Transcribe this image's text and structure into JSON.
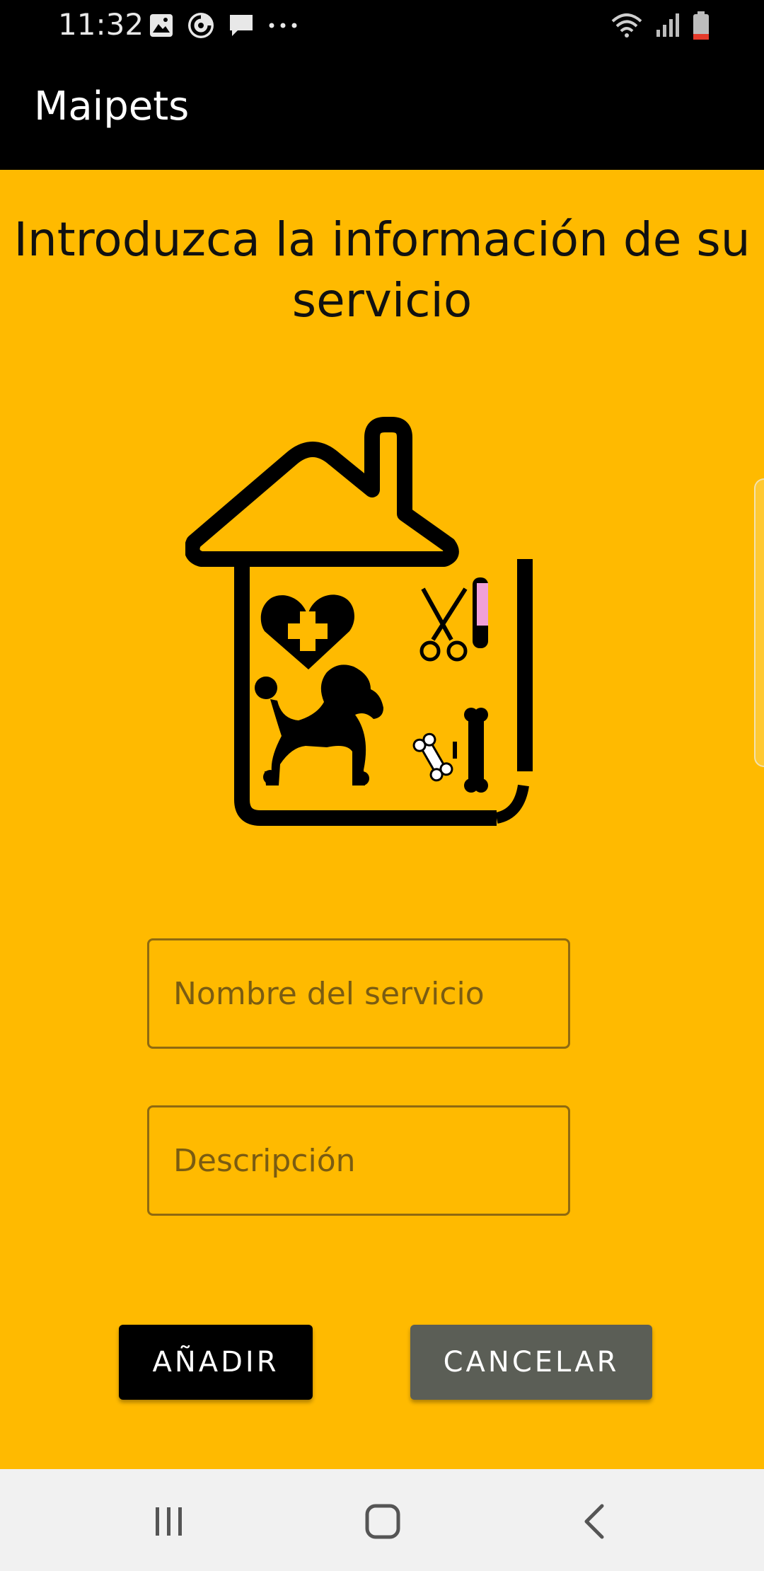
{
  "status_bar": {
    "time": "11:32",
    "left_icons": [
      "image-icon",
      "sync-icon",
      "message-icon",
      "more-icon"
    ],
    "right_icons": [
      "wifi-icon",
      "signal-icon",
      "battery-icon"
    ]
  },
  "app_bar": {
    "title": "Maipets"
  },
  "heading": {
    "line1": "Introduzca la información de su",
    "line2": "servicio"
  },
  "logo": {
    "icon": "pet-house-logo-icon"
  },
  "form": {
    "name_placeholder": "Nombre del servicio",
    "description_placeholder": "Descripción"
  },
  "buttons": {
    "add_label": "AÑADIR",
    "cancel_label": "CANCELAR"
  },
  "colors": {
    "background": "#FFBA00",
    "app_bar": "#000000",
    "add_button": "#000000",
    "cancel_button": "#5B5E56"
  },
  "nav_bar": {
    "icons": [
      "recent-apps-icon",
      "home-icon",
      "back-icon"
    ]
  }
}
